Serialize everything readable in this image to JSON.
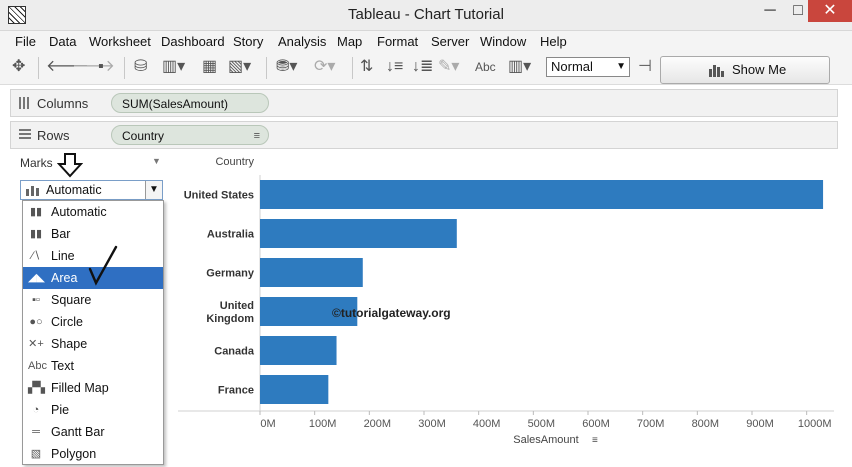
{
  "window": {
    "title": "Tableau - Chart Tutorial",
    "minimize": "─",
    "maximize": "□",
    "close": "✕"
  },
  "menu": [
    "File",
    "Data",
    "Worksheet",
    "Dashboard",
    "Story",
    "Analysis",
    "Map",
    "Format",
    "Server",
    "Window",
    "Help"
  ],
  "toolbar": {
    "label_abc": "Abc",
    "fit_select": "Normal",
    "show_me": "Show Me"
  },
  "shelves": {
    "columns": {
      "label": "Columns",
      "pill": "SUM(SalesAmount)"
    },
    "rows": {
      "label": "Rows",
      "pill": "Country"
    }
  },
  "marks": {
    "title": "Marks",
    "selected": "Automatic",
    "options": [
      {
        "label": "Automatic",
        "icon": "bar-chart-icon"
      },
      {
        "label": "Bar",
        "icon": "bar-chart-icon"
      },
      {
        "label": "Line",
        "icon": "line-chart-icon"
      },
      {
        "label": "Area",
        "icon": "area-chart-icon"
      },
      {
        "label": "Square",
        "icon": "square-icon"
      },
      {
        "label": "Circle",
        "icon": "circle-icon"
      },
      {
        "label": "Shape",
        "icon": "shape-icon"
      },
      {
        "label": "Text",
        "icon": "text-icon"
      },
      {
        "label": "Filled Map",
        "icon": "map-icon"
      },
      {
        "label": "Pie",
        "icon": "pie-icon"
      },
      {
        "label": "Gantt Bar",
        "icon": "gantt-icon"
      },
      {
        "label": "Polygon",
        "icon": "polygon-icon"
      }
    ],
    "highlighted": "Area"
  },
  "watermark": "©tutorialgateway.org",
  "colors": {
    "bar": "#2e7bbf",
    "selection": "#2f6fc2",
    "pill": "#dde5dd"
  },
  "chart_data": {
    "type": "bar",
    "orientation": "horizontal",
    "ylabel": "Country",
    "xlabel": "SalesAmount",
    "categories": [
      "United States",
      "Australia",
      "Germany",
      "United Kingdom",
      "Canada",
      "France"
    ],
    "category_labels": [
      [
        "United States"
      ],
      [
        "Australia"
      ],
      [
        "Germany"
      ],
      [
        "United",
        "Kingdom"
      ],
      [
        "Canada"
      ],
      [
        "France"
      ]
    ],
    "values": [
      1030,
      360,
      188,
      178,
      140,
      125
    ],
    "units": "M",
    "xlim": [
      0,
      1050
    ],
    "ticks": [
      0,
      100,
      200,
      300,
      400,
      500,
      600,
      700,
      800,
      900,
      1000
    ],
    "tick_labels": [
      "0M",
      "100M",
      "200M",
      "300M",
      "400M",
      "500M",
      "600M",
      "700M",
      "800M",
      "900M",
      "1000M"
    ],
    "grid": false
  }
}
